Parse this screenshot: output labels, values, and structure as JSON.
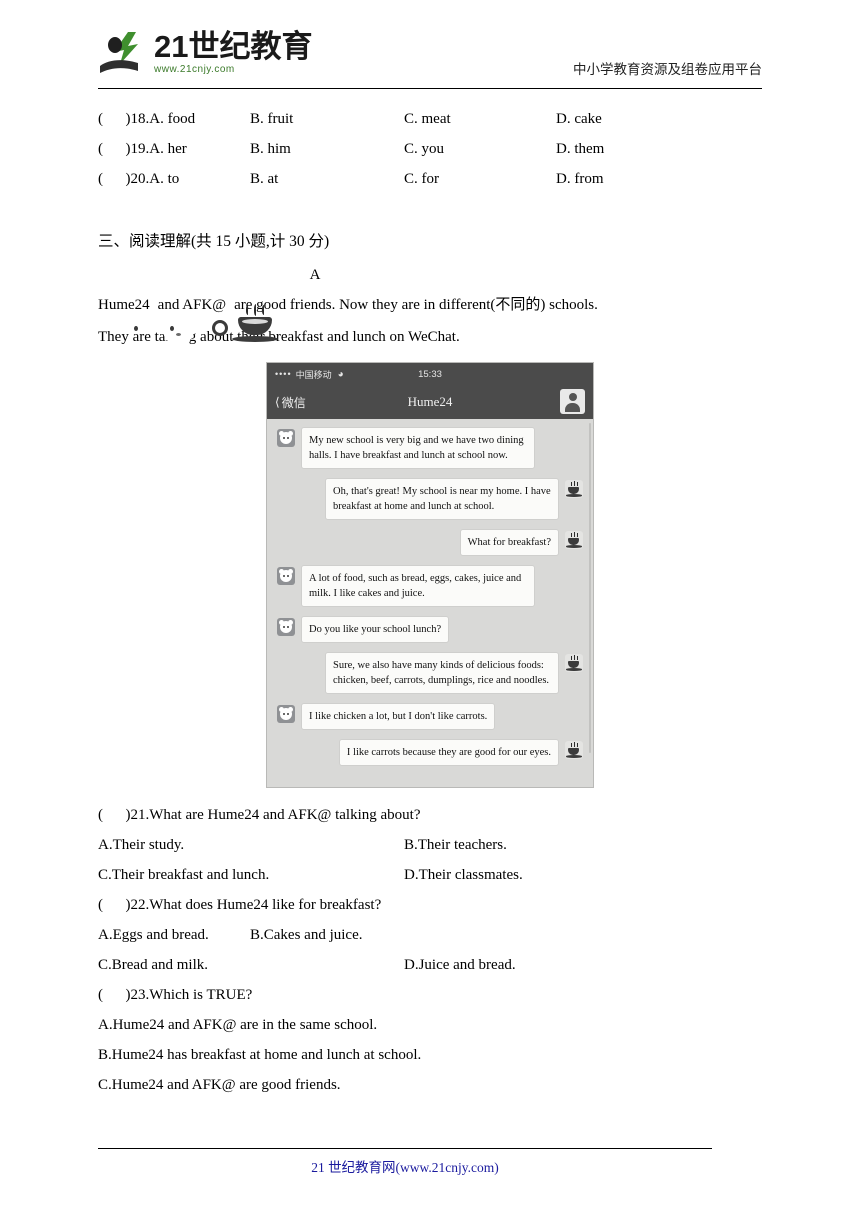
{
  "header": {
    "logo_title": "21世纪教育",
    "logo_sub": "www.21cnjy.com",
    "tagline": "中小学教育资源及组卷应用平台"
  },
  "vocab_rows": [
    {
      "stem": "(      )18.A. food",
      "b": "B. fruit",
      "c": "C. meat",
      "d": "D. cake"
    },
    {
      "stem": "(      )19.A. her",
      "b": "B. him",
      "c": "C. you",
      "d": "D. them"
    },
    {
      "stem": "(      )20.A. to",
      "b": "B. at",
      "c": "C. for",
      "d": "D. from"
    }
  ],
  "section": {
    "title": "三、阅读理解(共 15 小题,计 30 分)",
    "letter": "A"
  },
  "passage": {
    "name1": "Hume24",
    "icon1": "rabbit-avatar-icon",
    "join": "and",
    "name2": "AFK@",
    "icon2": "coffee-cup-icon",
    "text_after": "are good friends. Now they are in different(不同的) schools.",
    "line2": "They are talking about their breakfast and lunch on WeChat."
  },
  "wechat": {
    "status": {
      "dots": "••••",
      "carrier": "中国移动",
      "wifi": "wifi-icon",
      "time": "15:33"
    },
    "nav": {
      "back_icon": "chevron-left-icon",
      "back_label": "微信",
      "title": "Hume24",
      "profile_icon": "contact-profile-icon"
    },
    "messages": [
      {
        "side": "left",
        "avatar": "rabbit-avatar-icon",
        "text": "My new school is very big and we have two dining halls. I have breakfast and lunch at school now."
      },
      {
        "side": "right",
        "avatar": "coffee-cup-icon",
        "text": "Oh, that's great! My school is near my home. I have breakfast at home and lunch at school."
      },
      {
        "side": "right",
        "avatar": "coffee-cup-icon",
        "text": "What for breakfast?"
      },
      {
        "side": "left",
        "avatar": "rabbit-avatar-icon",
        "text": "A lot of food, such as bread, eggs, cakes, juice and milk. I like cakes and juice."
      },
      {
        "side": "left",
        "avatar": "rabbit-avatar-icon",
        "text": "Do you like your school lunch?"
      },
      {
        "side": "right",
        "avatar": "coffee-cup-icon",
        "text": "Sure, we also have many kinds of delicious foods: chicken, beef, carrots, dumplings, rice and noodles."
      },
      {
        "side": "left",
        "avatar": "rabbit-avatar-icon",
        "text": "I like chicken a lot, but I don't like carrots."
      },
      {
        "side": "right",
        "avatar": "coffee-cup-icon",
        "text": "I like carrots because they are good for our eyes."
      }
    ]
  },
  "questions": [
    {
      "stem": "(      )21.What are Hume24 and AFK@ talking about?",
      "row1a": "A.Their study.",
      "row1b": "B.Their teachers.",
      "row2a": "C.Their breakfast and lunch.",
      "row2b": "D.Their classmates.",
      "b_pos": "mid"
    },
    {
      "stem": "(      )22.What does Hume24 like for breakfast?",
      "row1a": "A.Eggs and bread.",
      "row1b": "B.Cakes and juice.",
      "row2a": "C.Bread and milk.",
      "row2b": "D.Juice and bread.",
      "b_pos": "near"
    }
  ],
  "question23": {
    "stem": "(      )23.Which is TRUE?",
    "a": "A.Hume24 and AFK@ are in the same school.",
    "b": "B.Hume24 has breakfast at home and lunch at school.",
    "c": "C.Hume24 and AFK@ are good friends."
  },
  "footer": {
    "text": "21 世纪教育网(www.21cnjy.com)"
  }
}
